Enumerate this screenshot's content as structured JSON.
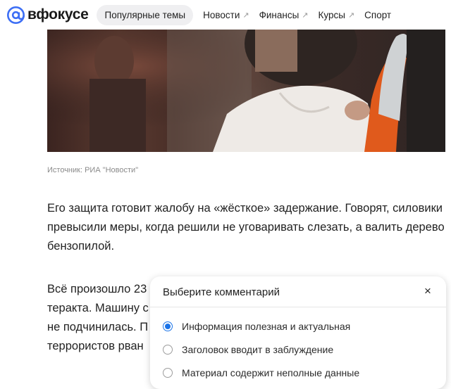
{
  "header": {
    "logo_text": "вфокусе",
    "nav": [
      {
        "label": "Популярные темы"
      },
      {
        "label": "Новости"
      },
      {
        "label": "Финансы"
      },
      {
        "label": "Курсы"
      },
      {
        "label": "Спорт"
      }
    ],
    "arrow_glyph": "↗"
  },
  "article": {
    "image_source": "Источник: РИА \"Новости\"",
    "paragraph_1": "Его защита готовит жалобу на «жёсткое» задержание. Говорят, силовики превысили меры, когда решили не уговаривать слезать, а валить дерево бензопилой.",
    "paragraph_2_lines": [
      "Всё произошло 23",
      "теракта. Машину с",
      "не подчинилась. П",
      "террористов рван"
    ]
  },
  "modal": {
    "title": "Выберите комментарий",
    "close_icon": "×",
    "options": [
      {
        "label": "Информация полезная и актуальная",
        "checked": true
      },
      {
        "label": "Заголовок вводит в заблуждение",
        "checked": false
      },
      {
        "label": "Материал содержит неполные данные",
        "checked": false
      }
    ]
  },
  "colors": {
    "accent": "#1a73e8",
    "logo": "#3d6ff5"
  }
}
